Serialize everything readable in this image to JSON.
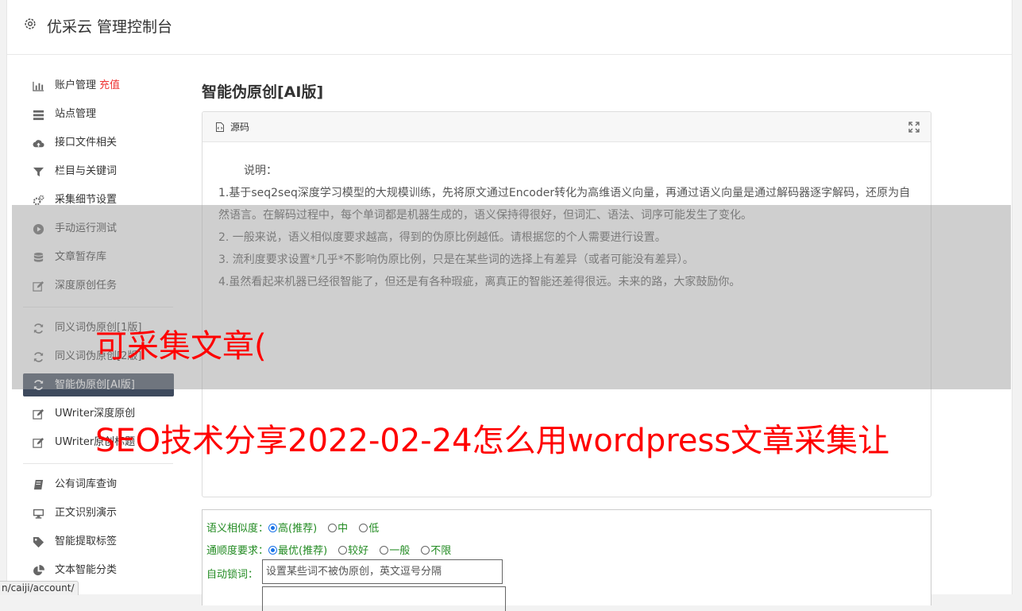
{
  "header": {
    "title": "优采云 管理控制台"
  },
  "sidebar": {
    "group1": [
      {
        "label": "账户管理",
        "badge": "充值",
        "icon": "bar-chart-icon"
      },
      {
        "label": "站点管理",
        "icon": "list-icon"
      },
      {
        "label": "接口文件相关",
        "icon": "cloud-upload-icon"
      },
      {
        "label": "栏目与关键词",
        "icon": "filter-icon"
      },
      {
        "label": "采集细节设置",
        "icon": "cogs-icon"
      },
      {
        "label": "手动运行测试",
        "icon": "play-circle-icon"
      },
      {
        "label": "文章暂存库",
        "icon": "database-icon"
      },
      {
        "label": "深度原创任务",
        "icon": "edit-icon"
      }
    ],
    "group2": [
      {
        "label": "同义词伪原创[1版]",
        "icon": "refresh-icon"
      },
      {
        "label": "同义词伪原创[2版]",
        "icon": "refresh-icon"
      },
      {
        "label": "智能伪原创[AI版]",
        "icon": "refresh-icon",
        "active": true
      },
      {
        "label": "UWriter深度原创",
        "icon": "edit-icon"
      },
      {
        "label": "UWriter原创标题",
        "icon": "edit-icon"
      }
    ],
    "group3": [
      {
        "label": "公有词库查询",
        "icon": "book-icon"
      },
      {
        "label": "正文识别演示",
        "icon": "desktop-icon"
      },
      {
        "label": "智能提取标签",
        "icon": "tag-icon"
      },
      {
        "label": "文本智能分类",
        "icon": "pie-chart-icon"
      }
    ]
  },
  "main": {
    "title": "智能伪原创[AI版]",
    "panel": {
      "label": "源码",
      "intro": "说明：",
      "lines": [
        "1.基于seq2seq深度学习模型的大规模训练，先将原文通过Encoder转化为高维语义向量，再通过语义向量是通过解码器逐字解码，还原为自然语言。在解码过程中，每个单词都是机器生成的，语义保持得很好，但词汇、语法、词序可能发生了变化。",
        "2. 一般来说，语义相似度要求越高，得到的伪原比例越低。请根据您的个人需要进行设置。",
        "3. 流利度要求设置*几乎*不影响伪原比例，只是在某些词的选择上有差异（或者可能没有差异）。",
        "4.虽然看起来机器已经很智能了，但还是有各种瑕疵，离真正的智能还差得很远。未来的路，大家鼓励你。"
      ]
    },
    "settings": {
      "similarity_label": "语义相似度：",
      "similarity_options": [
        "高(推荐)",
        "中",
        "低"
      ],
      "fluency_label": "通顺度要求：",
      "fluency_options": [
        "最优(推荐)",
        "较好",
        "一般",
        "不限"
      ],
      "lock_label": "自动锁词：",
      "lock_placeholder": "设置某些词不被伪原创，英文逗号分隔"
    }
  },
  "overlay": {
    "line1": "可采集文章(",
    "line2": "SEO技术分享2022-02-24怎么用wordpress文章采集让"
  },
  "statusbar": {
    "url": "n/caiji/account/"
  }
}
